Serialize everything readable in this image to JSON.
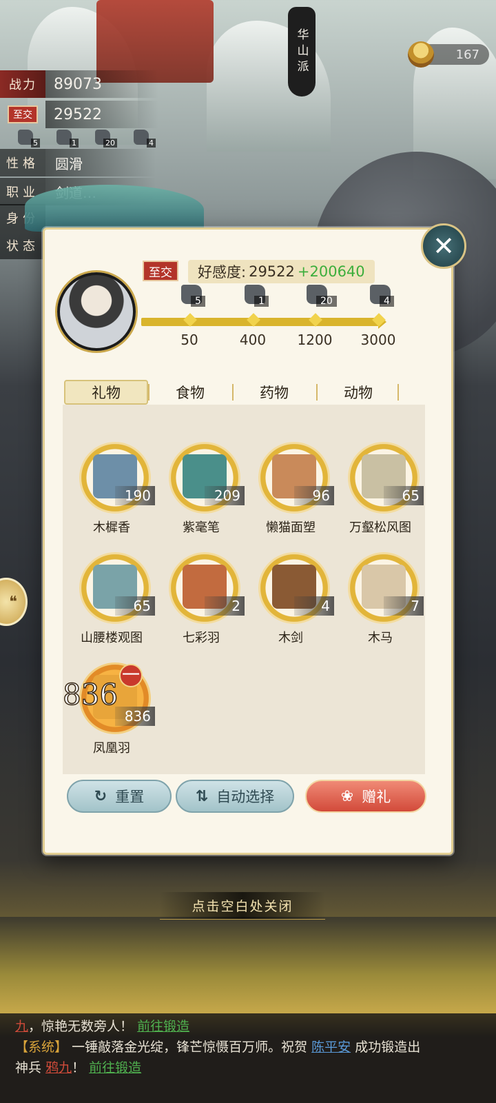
{
  "stats": {
    "power_label": "战力",
    "power_value": "89073",
    "relation_badge": "至交",
    "relation_value": "29522",
    "mini_gifts": [
      {
        "icon": "stone-icon",
        "count": "5"
      },
      {
        "icon": "stone-icon",
        "count": "1"
      },
      {
        "icon": "stone-icon",
        "count": "20"
      },
      {
        "icon": "stone-icon",
        "count": "4"
      }
    ],
    "personality_label": "性格",
    "personality_value": "圆滑",
    "job_label": "职业",
    "job_value": "剑道…",
    "identity_label": "身份",
    "status_label": "状态"
  },
  "sect_name": "华山派",
  "currency": {
    "icon": "bowl-icon",
    "value": "167"
  },
  "panel": {
    "relation_badge": "至交",
    "affinity_label": "好感度:",
    "affinity_value": "29522",
    "affinity_plus": "+200640",
    "milestones": [
      {
        "count": "5",
        "value": "50"
      },
      {
        "count": "1",
        "value": "400"
      },
      {
        "count": "20",
        "value": "1200"
      },
      {
        "count": "4",
        "value": "3000"
      }
    ],
    "tabs": [
      "礼物",
      "食物",
      "药物",
      "动物"
    ],
    "items": [
      {
        "name": "木樨香",
        "qty": "190",
        "color": "#6d8fa8"
      },
      {
        "name": "紫毫笔",
        "qty": "209",
        "color": "#4a8f8a"
      },
      {
        "name": "懒猫面塑",
        "qty": "96",
        "color": "#c98a5a"
      },
      {
        "name": "万壑松风图",
        "qty": "65",
        "color": "#c9c0a3"
      },
      {
        "name": "山腰楼观图",
        "qty": "65",
        "color": "#7aa3a8"
      },
      {
        "name": "七彩羽",
        "qty": "2",
        "color": "#c26b3f"
      },
      {
        "name": "木剑",
        "qty": "4",
        "color": "#8a5a34"
      },
      {
        "name": "木马",
        "qty": "7",
        "color": "#d9c7a8"
      },
      {
        "name": "凤凰羽",
        "qty": "836",
        "color": "#e8a53a",
        "selected_count": "836"
      }
    ],
    "minus_symbol": "一",
    "btn_reset": "重置",
    "btn_auto": "自动选择",
    "btn_give": "赠礼"
  },
  "close_hint": "点击空白处关闭",
  "chat": {
    "line1": {
      "name": "九",
      "text": "，惊艳无数旁人！",
      "link": "前往锻造"
    },
    "line2": {
      "tag": "【系统】",
      "text": "一锤敲落金光绽，锋芒惊慑百万师。祝贺",
      "player": "陈平安",
      "text2": "成功锻造出"
    },
    "line3": {
      "prefix": "神兵",
      "weapon": "鸦九",
      "text": "！",
      "link": "前往锻造"
    }
  },
  "colors": {
    "accent_gold": "#d9b42c",
    "relation_red": "#b3342a",
    "plus_green": "#3cae3c"
  }
}
